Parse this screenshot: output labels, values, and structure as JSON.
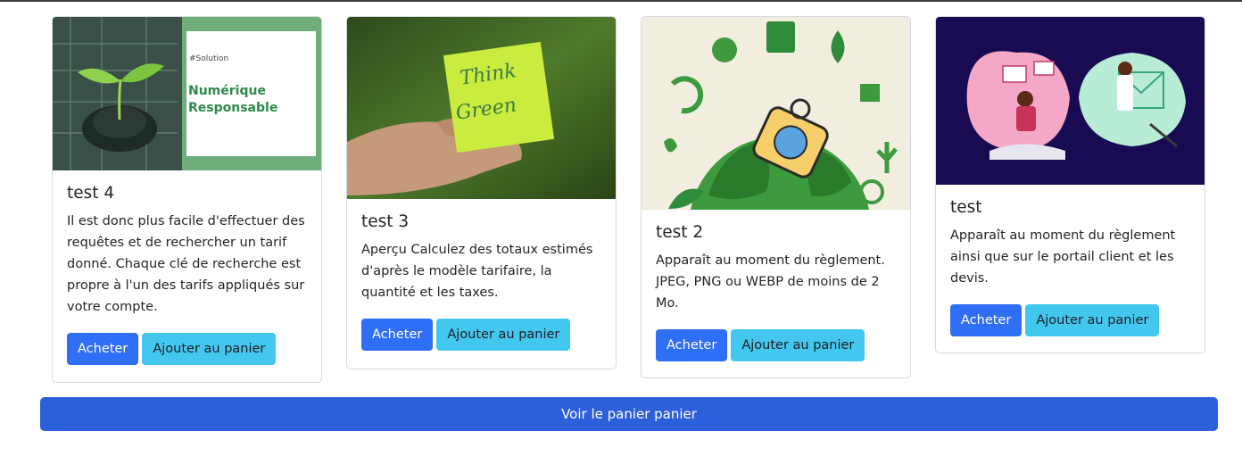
{
  "products": [
    {
      "title": "test 4",
      "description": "Il est donc plus facile d'effectuer des requêtes et de rechercher un tarif donné. Chaque clé de recherche est propre à l'un des tarifs appliqués sur votre compte.",
      "image_caption_tag": "#Solution",
      "image_caption_line1": "Numérique",
      "image_caption_line2": "Responsable",
      "buy_label": "Acheter",
      "add_label": "Ajouter au panier"
    },
    {
      "title": "test 3",
      "description": "Aperçu Calculez des totaux estimés d'après le modèle tarifaire, la quantité et les taxes.",
      "image_note_line1": "Think",
      "image_note_line2": "Green",
      "buy_label": "Acheter",
      "add_label": "Ajouter au panier"
    },
    {
      "title": "test 2",
      "description": "Apparaît au moment du règlement. JPEG, PNG ou WEBP de moins de 2 Mo.",
      "buy_label": "Acheter",
      "add_label": "Ajouter au panier"
    },
    {
      "title": "test",
      "description": "Apparaît au moment du règlement ainsi que sur le portail client et les devis.",
      "buy_label": "Acheter",
      "add_label": "Ajouter au panier"
    }
  ],
  "cart_bar_label": "Voir le panier panier",
  "colors": {
    "primary": "#2f6ff5",
    "info": "#44c7ef",
    "cart_bar": "#2c5fd9"
  }
}
